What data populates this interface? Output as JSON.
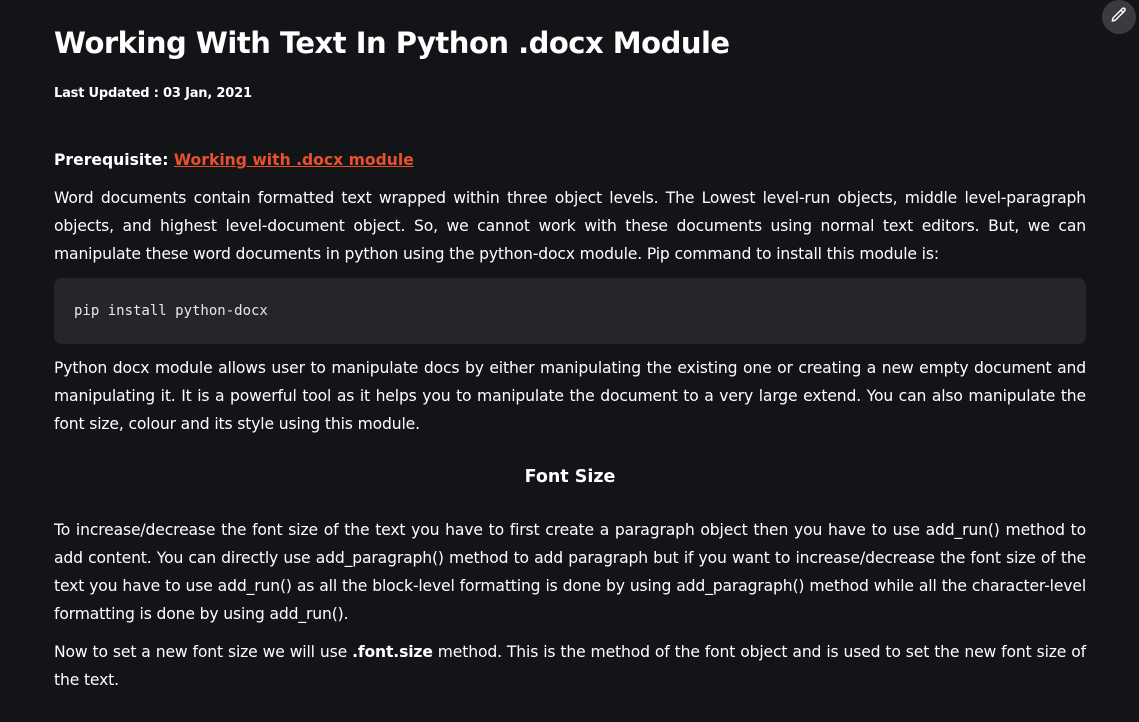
{
  "article": {
    "title": "Working With Text In Python .docx Module",
    "last_updated": "Last Updated : 03 Jan, 2021",
    "prerequisite_label": "Prerequisite: ",
    "prerequisite_link": "Working with .docx module",
    "paragraph1": "Word documents contain formatted text wrapped within three object levels. The Lowest level-run objects, middle level-paragraph objects, and highest level-document object. So, we cannot work with these documents using normal text editors. But, we can manipulate these word documents in python using the python-docx module. Pip command to install this module is:",
    "code": "pip install python-docx",
    "paragraph2": "Python docx module allows user to manipulate docs by either manipulating the existing one or creating a new empty document and manipulating it. It is a powerful tool as it helps you to manipulate the document to a very large extend. You can also manipulate the font size, colour and its style using this module.",
    "section_heading": "Font Size",
    "paragraph3": "To increase/decrease the font size of the text you have to first create a paragraph object then you have to use add_run() method to add content. You can directly use add_paragraph() method to add paragraph but if you want to increase/decrease the font size of the text you have to use add_run() as all the block-level formatting is done by using add_paragraph() method while all the character-level formatting is done by using add_run().",
    "paragraph4_before": "Now to set a new font size we will use ",
    "paragraph4_bold": ".font.size",
    "paragraph4_after": " method. This is the method of the font object and is used to set the new font size of the text."
  },
  "toolbar": {
    "edit_icon": "pencil-icon"
  },
  "colors": {
    "background": "#131417",
    "link": "#e8512c",
    "code_background": "#25262b"
  }
}
